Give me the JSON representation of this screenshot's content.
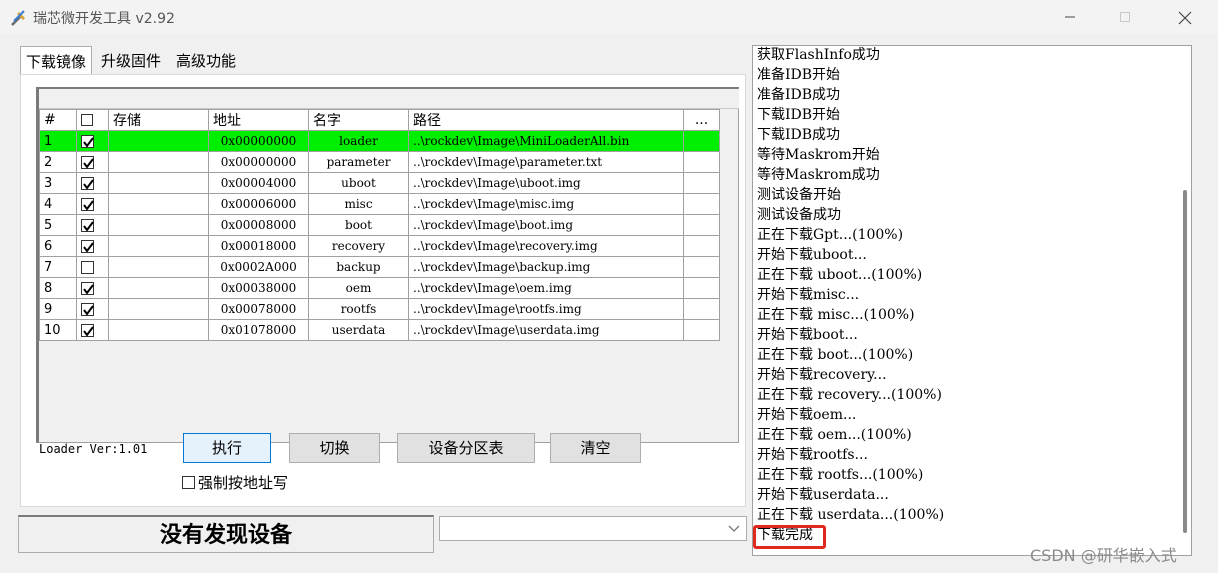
{
  "window": {
    "title": "瑞芯微开发工具 v2.92",
    "icons": {
      "app": "tools-icon",
      "minimize": "minimize-icon",
      "maximize": "maximize-icon",
      "close": "close-icon"
    }
  },
  "tabs": [
    {
      "label": "下载镜像",
      "active": true
    },
    {
      "label": "升级固件",
      "active": false
    },
    {
      "label": "高级功能",
      "active": false
    }
  ],
  "table": {
    "headers": {
      "no": "#",
      "storage": "存储",
      "address": "地址",
      "name": "名字",
      "path": "路径",
      "more": "..."
    },
    "rows": [
      {
        "no": "1",
        "checked": true,
        "storage": "",
        "address": "0x00000000",
        "name": "loader",
        "path": "..\\rockdev\\Image\\MiniLoaderAll.bin",
        "highlighted": true
      },
      {
        "no": "2",
        "checked": true,
        "storage": "",
        "address": "0x00000000",
        "name": "parameter",
        "path": "..\\rockdev\\Image\\parameter.txt",
        "highlighted": false
      },
      {
        "no": "3",
        "checked": true,
        "storage": "",
        "address": "0x00004000",
        "name": "uboot",
        "path": "..\\rockdev\\Image\\uboot.img",
        "highlighted": false
      },
      {
        "no": "4",
        "checked": true,
        "storage": "",
        "address": "0x00006000",
        "name": "misc",
        "path": "..\\rockdev\\Image\\misc.img",
        "highlighted": false
      },
      {
        "no": "5",
        "checked": true,
        "storage": "",
        "address": "0x00008000",
        "name": "boot",
        "path": "..\\rockdev\\Image\\boot.img",
        "highlighted": false
      },
      {
        "no": "6",
        "checked": true,
        "storage": "",
        "address": "0x00018000",
        "name": "recovery",
        "path": "..\\rockdev\\Image\\recovery.img",
        "highlighted": false
      },
      {
        "no": "7",
        "checked": false,
        "storage": "",
        "address": "0x0002A000",
        "name": "backup",
        "path": "..\\rockdev\\Image\\backup.img",
        "highlighted": false
      },
      {
        "no": "8",
        "checked": true,
        "storage": "",
        "address": "0x00038000",
        "name": "oem",
        "path": "..\\rockdev\\Image\\oem.img",
        "highlighted": false
      },
      {
        "no": "9",
        "checked": true,
        "storage": "",
        "address": "0x00078000",
        "name": "rootfs",
        "path": "..\\rockdev\\Image\\rootfs.img",
        "highlighted": false
      },
      {
        "no": "10",
        "checked": true,
        "storage": "",
        "address": "0x01078000",
        "name": "userdata",
        "path": "..\\rockdev\\Image\\userdata.img",
        "highlighted": false
      }
    ],
    "highlight_color": "#00ee00"
  },
  "controls": {
    "loader_version": "Loader Ver:1.01",
    "run_label": "执行",
    "switch_label": "切换",
    "partition_label": "设备分区表",
    "clear_label": "清空",
    "force_write_label": "强制按地址写",
    "force_write_checked": false
  },
  "status": {
    "text": "没有发现设备",
    "combo_value": ""
  },
  "log": {
    "lines": [
      "获取FlashInfo成功",
      "准备IDB开始",
      "准备IDB成功",
      "下载IDB开始",
      "下载IDB成功",
      "等待Maskrom开始",
      "等待Maskrom成功",
      "测试设备开始",
      "测试设备成功",
      "正在下载Gpt...(100%)",
      "开始下载uboot...",
      "正在下载 uboot...(100%)",
      "开始下载misc...",
      "正在下载 misc...(100%)",
      "开始下载boot...",
      "正在下载 boot...(100%)",
      "开始下载recovery...",
      "正在下载 recovery...(100%)",
      "开始下载oem...",
      "正在下载 oem...(100%)",
      "开始下载rootfs...",
      "正在下载 rootfs...(100%)",
      "开始下载userdata...",
      "正在下载 userdata...(100%)",
      "下载完成"
    ],
    "highlight_color": "#e0281e"
  },
  "watermark": "CSDN @研华嵌入式"
}
